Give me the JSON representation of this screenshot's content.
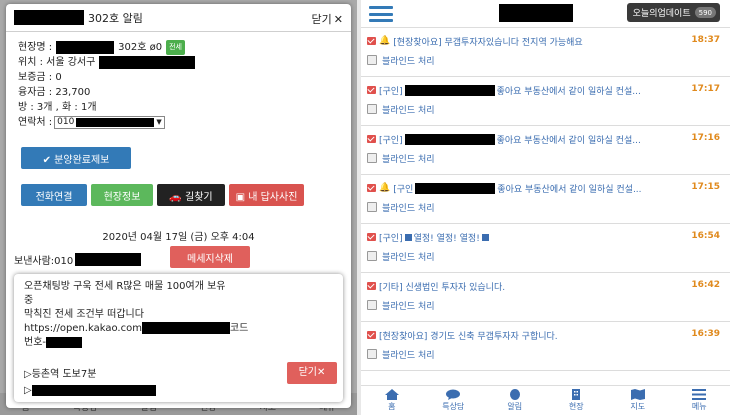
{
  "left": {
    "modal": {
      "title": "302호 알림",
      "close_label": "닫기",
      "close_x": "✕",
      "info": {
        "site_name_label": "현장명 :",
        "site_name_suffix": "302호 ø0",
        "new_badge": "전세",
        "location_label": "위치 : 서울 강서구",
        "deposit": "보증금 : 0",
        "loan": "융자금 : 23,700",
        "rooms": "방 : 3개 , 화 : 1개",
        "contact_label": "연락처 :",
        "contact_value": "010"
      },
      "report_button": "✔ 분양완료제보",
      "actions": {
        "call": "전화연결",
        "site_info": "현장정보",
        "route": "🚗 길찾기",
        "photo": "▣ 내 답사사진"
      },
      "date": "2020년 04월 17일 (금) 오후 4:04",
      "sender_label": "보낸사람:010",
      "delete_button": "메세지삭제",
      "message": {
        "line1": "오픈채팅방 구욱 전세 R많은 매물 100여개 보유",
        "line2": "중",
        "line3": "막칙진 전세 조건부 떠갑니다",
        "line4": "https://open.kakao.com",
        "line4_suffix": "코드",
        "line5": "번호-",
        "line6": "▷등촌역 도보7분",
        "line7": "▷"
      },
      "close_bottom": "닫기✕"
    },
    "bg_nav": [
      "홈",
      "특상담",
      "알림",
      "현장",
      "지도",
      "메뉴"
    ]
  },
  "right": {
    "today_button": "오늘의업데이트",
    "today_count": "590",
    "notifications": [
      {
        "title": "[현장찾아요] 무갭투자자있습니다 전지역 가능해요",
        "bell": true,
        "redact": false,
        "time": "18:37",
        "action": "블라인드 처리"
      },
      {
        "title": "[구인]",
        "title_suffix": "좋아요 부동산에서 같이 일하실 컨설...",
        "bell": false,
        "redact": true,
        "time": "17:17",
        "action": "블라인드 처리"
      },
      {
        "title": "[구인]",
        "title_suffix": "좋아요 부동산에서 같이 일하실 컨설...",
        "bell": false,
        "redact": true,
        "time": "17:16",
        "action": "블라인드 처리"
      },
      {
        "title": "[구인",
        "title_suffix": "좋아요 부동산에서 같이 일하실 컨설...",
        "bell": true,
        "redact": true,
        "time": "17:15",
        "action": "블라인드 처리"
      },
      {
        "title": "[구인]",
        "title_suffix": "열정! 열정! 열정!",
        "bell": false,
        "redact": false,
        "squares": true,
        "time": "16:54",
        "action": "블라인드 처리"
      },
      {
        "title": "[기타] 신생법인 투자자 있습니다.",
        "bell": false,
        "redact": false,
        "time": "16:42",
        "action": "블라인드 처리"
      },
      {
        "title": "[현장찾아요] 경기도 신축 무갭투자자 구합니다.",
        "bell": false,
        "redact": false,
        "time": "16:39",
        "action": "블라인드 처리"
      }
    ],
    "bottom_nav": [
      {
        "label": "홈",
        "icon": "home-icon"
      },
      {
        "label": "특상담",
        "icon": "chat-icon"
      },
      {
        "label": "알림",
        "icon": "bell-icon"
      },
      {
        "label": "현장",
        "icon": "building-icon"
      },
      {
        "label": "지도",
        "icon": "map-icon"
      },
      {
        "label": "메뉴",
        "icon": "menu-icon"
      }
    ]
  }
}
